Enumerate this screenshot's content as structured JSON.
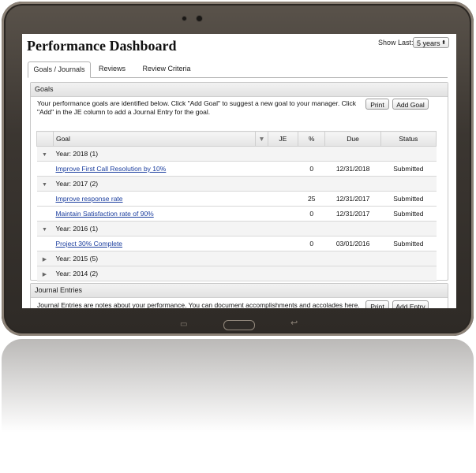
{
  "app": {
    "title": "Performance Dashboard"
  },
  "filter": {
    "label": "Show Last:",
    "value": "5 years"
  },
  "tabs": [
    {
      "label": "Goals / Journals",
      "active": true
    },
    {
      "label": "Reviews",
      "active": false
    },
    {
      "label": "Review Criteria",
      "active": false
    }
  ],
  "goals": {
    "heading": "Goals",
    "description": "Your performance goals are identified below. Click \"Add Goal\" to suggest a new goal to your manager. Click \"Add\" in the JE column to add a Journal Entry for the goal.",
    "print_label": "Print",
    "add_label": "Add Goal",
    "columns": [
      "Goal",
      "JE",
      "%",
      "Due",
      "Status"
    ],
    "groups": [
      {
        "label": "Year: 2018 (1)",
        "expanded": true,
        "rows": [
          {
            "goal": "Improve First Call Resolution by 10%",
            "pct": "0",
            "due": "12/31/2018",
            "status": "Submitted"
          }
        ]
      },
      {
        "label": "Year: 2017 (2)",
        "expanded": true,
        "rows": [
          {
            "goal": "Improve response rate",
            "pct": "25",
            "due": "12/31/2017",
            "status": "Submitted"
          },
          {
            "goal": "Maintain Satisfaction rate of 90%",
            "pct": "0",
            "due": "12/31/2017",
            "status": "Submitted"
          }
        ]
      },
      {
        "label": "Year: 2016 (1)",
        "expanded": true,
        "rows": [
          {
            "goal": "Project 30% Complete",
            "pct": "0",
            "due": "03/01/2016",
            "status": "Submitted"
          }
        ]
      },
      {
        "label": "Year: 2015 (5)",
        "expanded": false,
        "rows": []
      },
      {
        "label": "Year: 2014 (2)",
        "expanded": false,
        "rows": []
      }
    ]
  },
  "journal": {
    "heading": "Journal Entries",
    "description": "Journal Entries are notes about your performance. You can document accomplishments and accolades here.",
    "print_label": "Print",
    "add_label": "Add Entry"
  },
  "colors": {
    "link": "#1a3d9e",
    "bezel": "#3b3631"
  }
}
